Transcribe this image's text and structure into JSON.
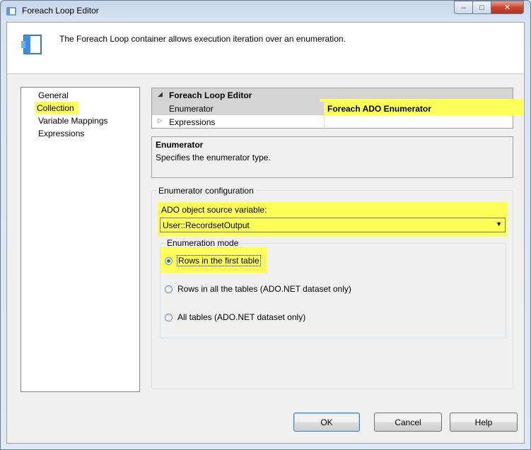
{
  "window": {
    "title": "Foreach Loop Editor"
  },
  "header": {
    "text": "The Foreach Loop container allows execution iteration over an enumeration."
  },
  "nav": {
    "items": [
      "General",
      "Collection",
      "Variable Mappings",
      "Expressions"
    ],
    "selected": "Collection"
  },
  "grid": {
    "category": "Foreach Loop Editor",
    "rows": [
      {
        "name": "Enumerator",
        "value": "Foreach ADO Enumerator"
      },
      {
        "name": "Expressions",
        "value": ""
      }
    ]
  },
  "description": {
    "title": "Enumerator",
    "text": "Specifies the enumerator type."
  },
  "config": {
    "legend": "Enumerator configuration",
    "ado_label": "ADO object source variable:",
    "ado_value": "User::RecordsetOutput",
    "mode_legend": "Enumeration mode",
    "modes": [
      {
        "label": "Rows in the first table",
        "selected": true
      },
      {
        "label": "Rows in all the tables (ADO.NET dataset only)",
        "selected": false
      },
      {
        "label": "All tables (ADO.NET dataset only)",
        "selected": false
      }
    ]
  },
  "buttons": {
    "ok": "OK",
    "cancel": "Cancel",
    "help": "Help"
  },
  "colors": {
    "highlight": "#ffff5a",
    "close_button": "#c9452f",
    "radio_checked": "#2e8b32"
  },
  "icons": {
    "app": "foreach-loop-icon",
    "header": "foreach-loop-icon",
    "minimize": "minimize-icon",
    "maximize": "maximize-icon",
    "close": "close-icon",
    "dropdown": "chevron-down-icon"
  }
}
